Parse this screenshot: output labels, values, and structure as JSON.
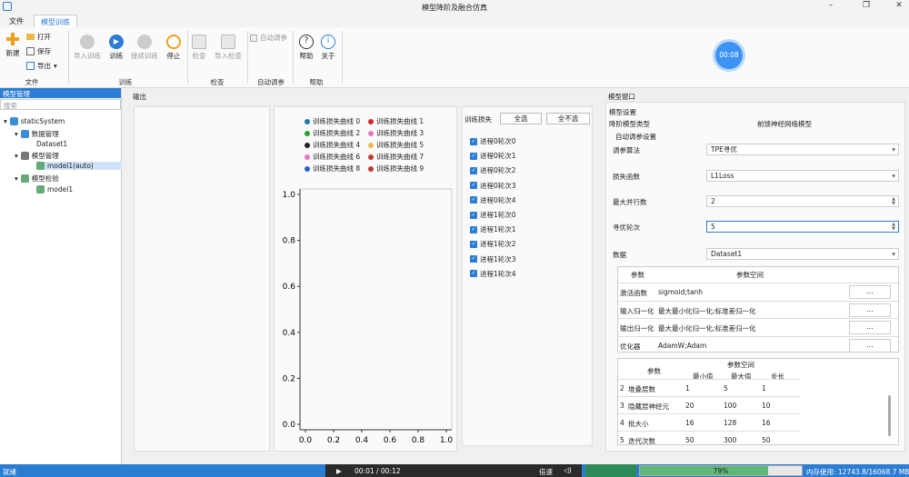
{
  "window": {
    "title": "模型降阶及融合仿真",
    "min": "–",
    "max": "❐",
    "close": "✕"
  },
  "tabs": [
    {
      "label": "文件"
    },
    {
      "label": "模型训练"
    }
  ],
  "ribbon": {
    "new": "新建",
    "open": "打开",
    "save": "保存",
    "export": "导出",
    "import_train": "导入训练",
    "train": "训练",
    "continue_train": "接续训练",
    "stop": "停止",
    "check": "检查",
    "import_check": "导入检查",
    "auto_tune": "自动调参",
    "help": "帮助",
    "about": "关于",
    "groups": {
      "file": "文件",
      "train": "训练",
      "check": "检查",
      "auto": "自动调参",
      "help": "帮助"
    },
    "timer": "00:08"
  },
  "sidebar": {
    "header": "模型管理",
    "search_placeholder": "搜索",
    "tree": {
      "root": "staticSystem",
      "data_mgmt": "数据管理",
      "dataset": "Dataset1",
      "model_mgmt": "模型管理",
      "model_auto": "model1(auto)",
      "model_check": "模型检验",
      "model1": "model1"
    }
  },
  "output": {
    "label": "输出"
  },
  "chart_data": {
    "type": "line",
    "legend": [
      "训练损失曲线 0",
      "训练损失曲线 1",
      "训练损失曲线 2",
      "训练损失曲线 3",
      "训练损失曲线 4",
      "训练损失曲线 5",
      "训练损失曲线 6",
      "训练损失曲线 7",
      "训练损失曲线 8",
      "训练损失曲线 9"
    ],
    "colors": [
      "#1f77b4",
      "#d62728",
      "#2ca02c",
      "#e377c2",
      "#222222",
      "#f0b84a",
      "#e377c2",
      "#c0392b",
      "#2f5fd0",
      "#c0392b"
    ],
    "xticks": [
      "0.0",
      "0.2",
      "0.4",
      "0.6",
      "0.8",
      "1.0"
    ],
    "yticks": [
      "0.0",
      "0.2",
      "0.4",
      "0.6",
      "0.8",
      "1.0"
    ],
    "xlim": [
      0,
      1
    ],
    "ylim": [
      0,
      1
    ],
    "series": []
  },
  "loss_panel": {
    "title": "训练损失",
    "select_all": "全选",
    "select_none": "全不选",
    "items": [
      "进程0轮次0",
      "进程0轮次1",
      "进程0轮次2",
      "进程0轮次3",
      "进程0轮次4",
      "进程1轮次0",
      "进程1轮次1",
      "进程1轮次2",
      "进程1轮次3",
      "进程1轮次4"
    ]
  },
  "model_window": {
    "title": "模型窗口",
    "settings": "模型设置",
    "type_label": "降阶模型类型",
    "type_value": "前馈神经网络模型",
    "auto_settings": "自动调参设置",
    "algo_label": "调参算法",
    "algo_value": "TPE寻优",
    "loss_label": "损失函数",
    "loss_value": "L1Loss",
    "parallel_label": "最大并行数",
    "parallel_value": "2",
    "iter_label": "寻优轮次",
    "iter_value": "5",
    "data_label": "数据",
    "data_value": "Dataset1",
    "table1": {
      "h_param": "参数",
      "h_space": "参数空间",
      "btn": "...",
      "rows": [
        {
          "name": "激活函数",
          "space": "sigmoid;tanh"
        },
        {
          "name": "输入归一化",
          "space": "最大最小化归一化;标准差归一化"
        },
        {
          "name": "输出归一化",
          "space": "最大最小化归一化;标准差归一化"
        },
        {
          "name": "优化器",
          "space": "AdamW;Adam"
        }
      ]
    },
    "table2": {
      "h_param": "参数",
      "h_space": "参数空间",
      "h_min": "最小值",
      "h_max": "最大值",
      "h_step": "步长",
      "rows": [
        {
          "idx": "2",
          "name": "堆叠层数",
          "min": "1",
          "max": "5",
          "step": "1"
        },
        {
          "idx": "3",
          "name": "隐藏层神经元",
          "min": "20",
          "max": "100",
          "step": "10"
        },
        {
          "idx": "4",
          "name": "批大小",
          "min": "16",
          "max": "128",
          "step": "16"
        },
        {
          "idx": "5",
          "name": "迭代次数",
          "min": "50",
          "max": "300",
          "step": "50"
        }
      ]
    }
  },
  "status": {
    "ready": "就绪",
    "time": "00:01 / 00:12",
    "speed": "倍速",
    "progress": "79%",
    "progress_value": 0.79,
    "memory": "内存使用: 12743.8/16068.7 MB"
  }
}
